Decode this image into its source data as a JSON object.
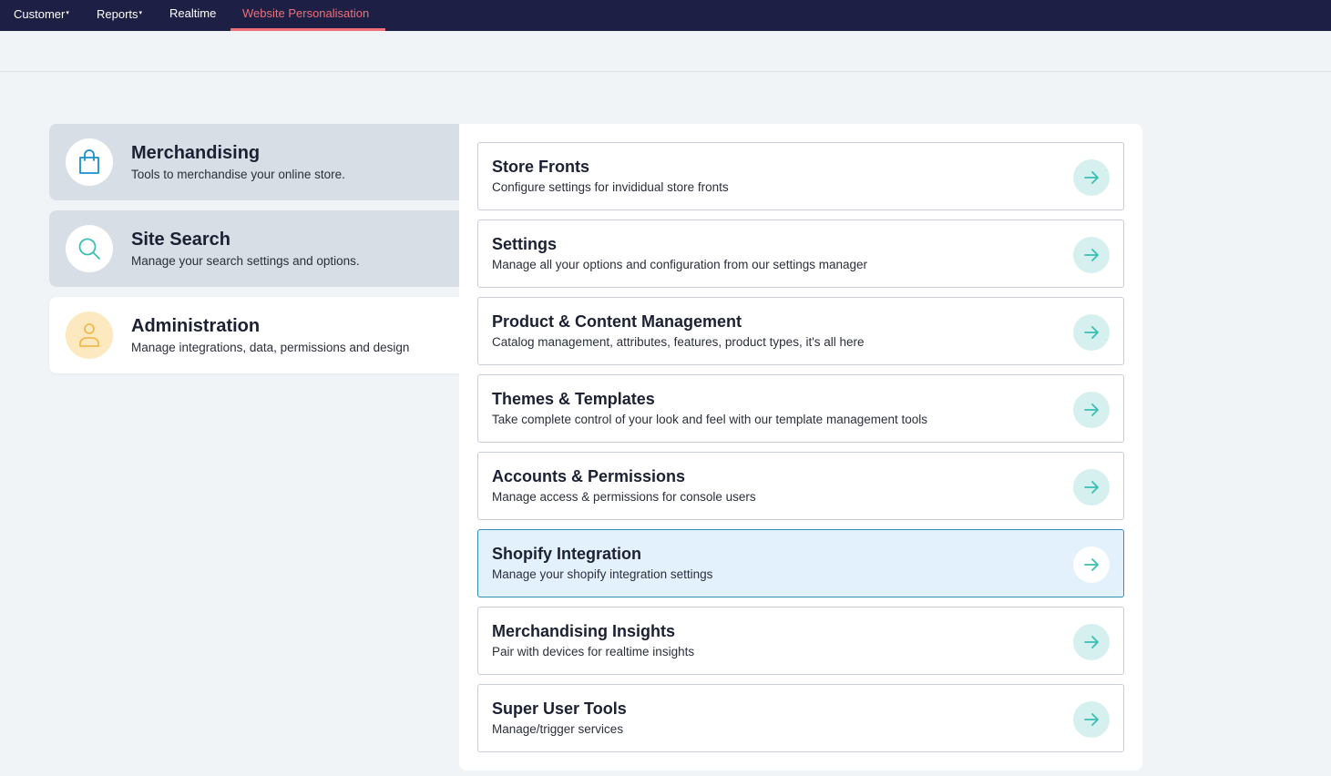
{
  "topnav": {
    "items": [
      {
        "label": "Customer",
        "caret": "▾"
      },
      {
        "label": "Reports",
        "caret": "▾"
      },
      {
        "label": "Realtime",
        "caret": ""
      },
      {
        "label": "Website Personalisation",
        "caret": ""
      }
    ],
    "active_index": 3,
    "colors": {
      "background": "#1d1f44",
      "active": "#ef6f78"
    }
  },
  "categories": [
    {
      "title": "Merchandising",
      "description": "Tools to merchandise your online store.",
      "icon": "shopping-bag-icon"
    },
    {
      "title": "Site Search",
      "description": "Manage your search settings and options.",
      "icon": "search-icon"
    },
    {
      "title": "Administration",
      "description": "Manage integrations, data, permissions and design",
      "icon": "user-icon",
      "selected": true
    }
  ],
  "cards": [
    {
      "title": "Store Fronts",
      "description": "Configure settings for invididual store fronts",
      "icon": "arrow-right-icon"
    },
    {
      "title": "Settings",
      "description": "Manage all your options and configuration from our settings manager",
      "icon": "arrow-right-icon"
    },
    {
      "title": "Product & Content Management",
      "description": "Catalog management, attributes, features, product types, it's all here",
      "icon": "arrow-right-icon"
    },
    {
      "title": "Themes & Templates",
      "description": "Take complete control of your look and feel with our template management tools",
      "icon": "arrow-right-icon"
    },
    {
      "title": "Accounts & Permissions",
      "description": "Manage access & permissions for console users",
      "icon": "arrow-right-icon"
    },
    {
      "title": "Shopify Integration",
      "description": "Manage your shopify integration settings",
      "icon": "arrow-right-icon",
      "highlighted": true
    },
    {
      "title": "Merchandising Insights",
      "description": "Pair with devices for realtime insights",
      "icon": "arrow-right-icon"
    },
    {
      "title": "Super User Tools",
      "description": "Manage/trigger services",
      "icon": "arrow-right-icon"
    }
  ],
  "colors": {
    "accent_teal": "#3bbfb3",
    "icon_blue": "#1a8fd0",
    "icon_orange": "#f4b33f",
    "page_bg": "#f0f4f7"
  }
}
